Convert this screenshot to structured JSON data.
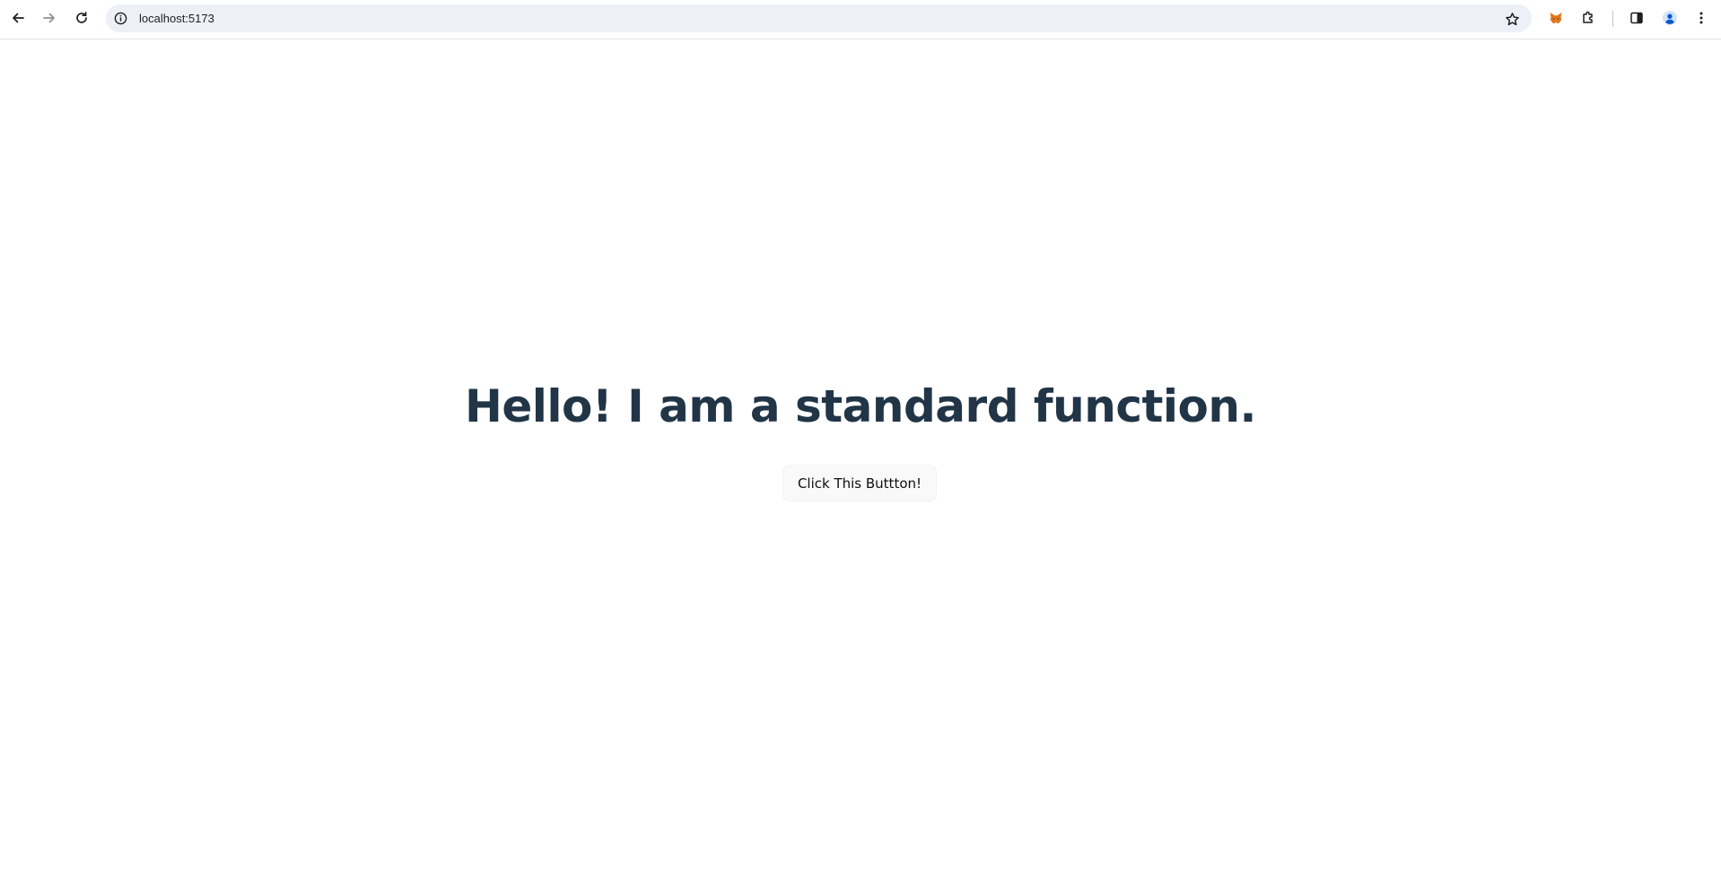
{
  "browser": {
    "url": "localhost:5173",
    "icons": {
      "back": "back-arrow-icon",
      "forward": "forward-arrow-icon",
      "reload": "reload-icon",
      "info": "site-info-icon",
      "bookmark": "star-icon",
      "extension_fox": "fox-extension-icon",
      "extensions": "puzzle-icon",
      "side_panel": "side-panel-icon",
      "profile": "profile-avatar-icon",
      "menu": "kebab-menu-icon"
    }
  },
  "page": {
    "heading": "Hello! I am a standard function.",
    "button_label": "Click This Buttton!"
  },
  "colors": {
    "heading": "#213547",
    "button_bg": "#f9f9f9",
    "omnibox_bg": "#edf0f7",
    "profile": "#0b57d0",
    "fox": "#e2761b"
  }
}
